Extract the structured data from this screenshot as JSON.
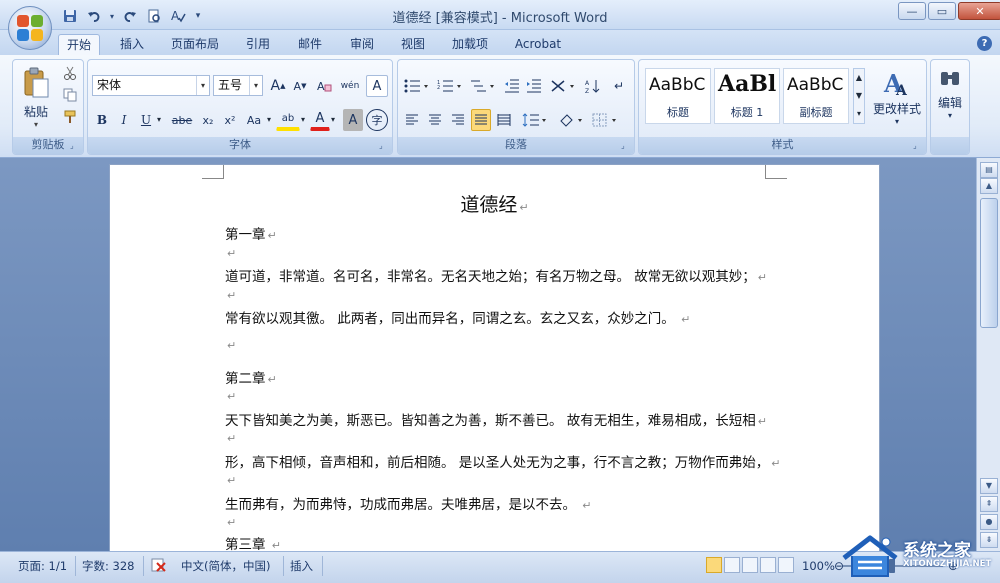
{
  "window": {
    "title": "道德经 [兼容模式] - Microsoft Word",
    "minimize_icon": "minimize-icon",
    "maximize_icon": "maximize-icon",
    "close_icon": "close-icon"
  },
  "quick_access": {
    "icons": [
      "save-icon",
      "undo-icon",
      "redo-icon",
      "print-preview-icon",
      "spelling-icon",
      "customize-qat-icon"
    ]
  },
  "tabs": [
    {
      "label": "开始",
      "active": true
    },
    {
      "label": "插入"
    },
    {
      "label": "页面布局"
    },
    {
      "label": "引用"
    },
    {
      "label": "邮件"
    },
    {
      "label": "审阅"
    },
    {
      "label": "视图"
    },
    {
      "label": "加载项"
    },
    {
      "label": "Acrobat"
    }
  ],
  "ribbon": {
    "clipboard": {
      "label": "剪贴板",
      "paste_label": "粘贴"
    },
    "font": {
      "label": "字体",
      "font_name": "宋体",
      "font_size": "五号",
      "grow": "A",
      "shrink": "A",
      "phonetic": "wén",
      "charborder": "A",
      "bold": "B",
      "italic": "I",
      "underline": "U",
      "strike": "abe",
      "subscript": "x₂",
      "superscript": "x²",
      "changecase": "Aa",
      "highlight": "ab",
      "fontcolor": "A",
      "shading": "A",
      "enclose": "字"
    },
    "paragraph": {
      "label": "段落"
    },
    "styles": {
      "label": "样式",
      "cards": [
        {
          "sample": "AaBbC",
          "name": "标题"
        },
        {
          "sample": "AaBl",
          "name": "标题 1"
        },
        {
          "sample": "AaBbC",
          "name": "副标题"
        }
      ],
      "change_styles_label": "更改样式"
    },
    "editing": {
      "label": "编辑"
    }
  },
  "document": {
    "title": "道德经",
    "paragraph_mark": "↵",
    "lines": [
      {
        "text": "第一章"
      },
      {
        "text": ""
      },
      {
        "text": "道可道，非常道。名可名，非常名。无名天地之始；有名万物之母。 故常无欲以观其妙；"
      },
      {
        "text": ""
      },
      {
        "text": "常有欲以观其徼。 此两者，同出而异名，同谓之玄。玄之又玄，众妙之门。 "
      },
      {
        "text": ""
      },
      {
        "text": ""
      },
      {
        "text": "第二章"
      },
      {
        "text": ""
      },
      {
        "text": "天下皆知美之为美，斯恶已。皆知善之为善，斯不善已。 故有无相生，难易相成，长短相"
      },
      {
        "text": ""
      },
      {
        "text": "形，高下相倾，音声相和，前后相随。 是以圣人处无为之事，行不言之教；万物作而弗始，"
      },
      {
        "text": ""
      },
      {
        "text": "生而弗有，为而弗恃，功成而弗居。夫唯弗居，是以不去。 "
      },
      {
        "text": ""
      },
      {
        "text": "第三章 "
      }
    ]
  },
  "status": {
    "page": "页面: 1/1",
    "words": "字数: 328",
    "language": "中文(简体，中国)",
    "mode": "插入",
    "zoom": "100%"
  },
  "watermark": {
    "cn": "系统之家",
    "en": "XITONGZHIJIA.NET"
  },
  "colors": {
    "accent": "#3d6bb3",
    "ribbon_bg": "#dfe9f7",
    "workspace": "#6f8db8"
  }
}
